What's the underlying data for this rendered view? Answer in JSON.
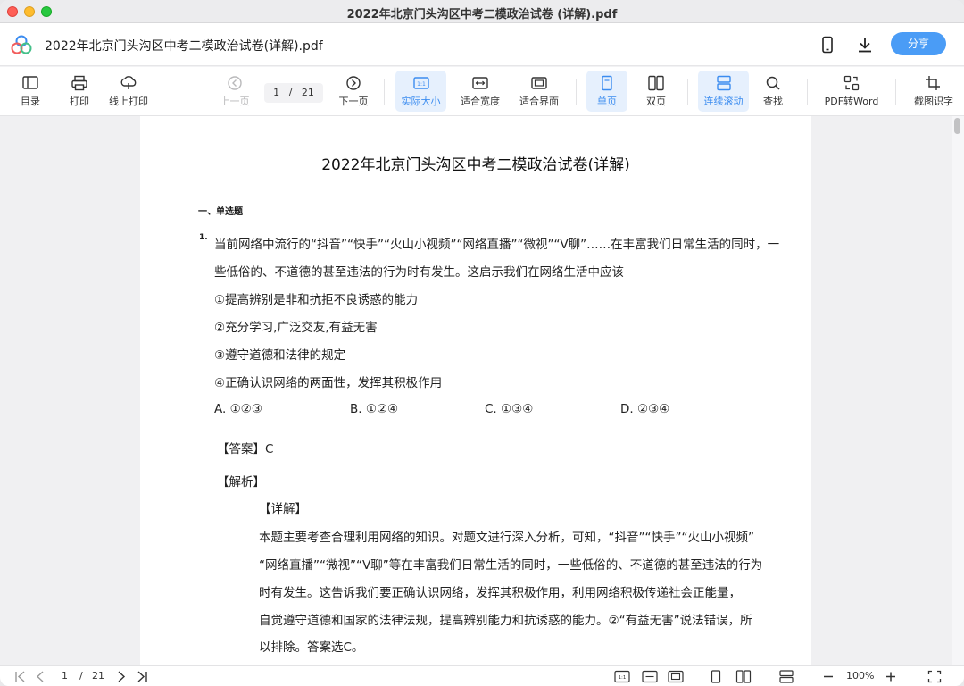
{
  "window": {
    "title": "2022年北京门头沟区中考二模政治试卷 (详解).pdf"
  },
  "header": {
    "doc_title": "2022年北京门头沟区中考二模政治试卷(详解).pdf",
    "share_label": "分享"
  },
  "toolbar": {
    "toc": "目录",
    "print": "打印",
    "online_print": "线上打印",
    "prev_page": "上一页",
    "current_page": "1",
    "page_sep": "/",
    "total_pages": "21",
    "next_page": "下一页",
    "actual_size": "实际大小",
    "fit_width": "适合宽度",
    "fit_page": "适合界面",
    "single_page": "单页",
    "double_page": "双页",
    "continuous_scroll": "连续滚动",
    "find": "查找",
    "pdf_to_word": "PDF转Word",
    "ocr": "截图识字",
    "accent": "#3b8cf0"
  },
  "document": {
    "title": "2022年北京门头沟区中考二模政治试卷(详解)",
    "section": "一、单选题",
    "question_number": "1.",
    "q_line1": "当前网络中流行的“抖音”“快手”“火山小视频”“网络直播”“微视”“V聊”……在丰富我们日常生活的同时，一",
    "q_line2": "些低俗的、不道德的甚至违法的行为时有发生。这启示我们在网络生活中应该",
    "item1": "①提高辨别是非和抗拒不良诱惑的能力",
    "item2": "②充分学习,广泛交友,有益无害",
    "item3": "③遵守道德和法律的规定",
    "item4": "④正确认识网络的两面性，发挥其积极作用",
    "options": [
      "A. ①②③",
      "B. ①②④",
      "C. ①③④",
      "D. ②③④"
    ],
    "answer": "【答案】C",
    "analysis": "【解析】",
    "detail": "【详解】",
    "exp1": "本题主要考查合理利用网络的知识。对题文进行深入分析，可知，“抖音”“快手”“火山小视频”",
    "exp2": "“网络直播”“微视”“V聊”等在丰富我们日常生活的同时，一些低俗的、不道德的甚至违法的行为",
    "exp3": "时有发生。这告诉我们要正确认识网络，发挥其积极作用，利用网络积极传递社会正能量，",
    "exp4": "自觉遵守道德和国家的法律法规，提高辨别能力和抗诱惑的能力。②“有益无害”说法错误，所",
    "exp5": "以排除。答案选C。"
  },
  "statusbar": {
    "current_page": "1",
    "page_sep": "/",
    "total_pages": "21",
    "zoom": "100%"
  }
}
